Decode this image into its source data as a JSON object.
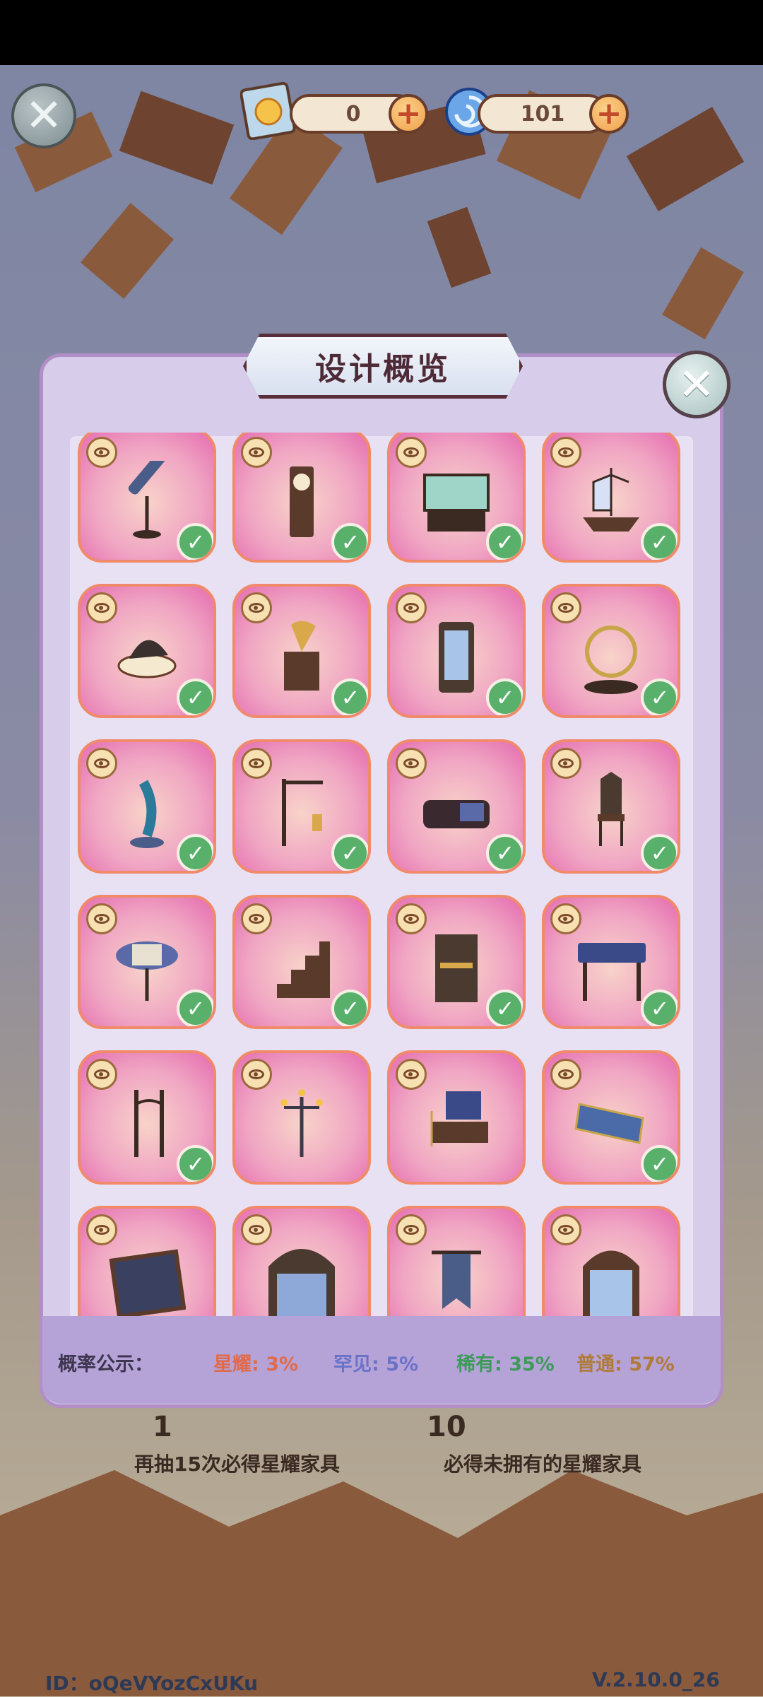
{
  "hud": {
    "currency1_value": "0",
    "currency2_value": "101"
  },
  "modal": {
    "title": "设计概览",
    "cards": [
      {
        "item": "telescope",
        "owned": true
      },
      {
        "item": "grandfather-clock",
        "owned": true
      },
      {
        "item": "aquarium",
        "owned": true
      },
      {
        "item": "ship-model",
        "owned": true
      },
      {
        "item": "dragon-table",
        "owned": true
      },
      {
        "item": "gramophone",
        "owned": true
      },
      {
        "item": "display-cabinet",
        "owned": true
      },
      {
        "item": "astrolabe",
        "owned": true
      },
      {
        "item": "peacock-statue",
        "owned": true
      },
      {
        "item": "lantern-stand",
        "owned": true
      },
      {
        "item": "sofa",
        "owned": true
      },
      {
        "item": "gothic-chair",
        "owned": true
      },
      {
        "item": "chess-table",
        "owned": true
      },
      {
        "item": "staircase",
        "owned": true
      },
      {
        "item": "desk-cabinet",
        "owned": true
      },
      {
        "item": "starry-table",
        "owned": true
      },
      {
        "item": "street-lamp",
        "owned": true
      },
      {
        "item": "candelabra",
        "owned": false
      },
      {
        "item": "scale-desk",
        "owned": false
      },
      {
        "item": "star-rug",
        "owned": true
      },
      {
        "item": "butterfly-frame",
        "owned": false
      },
      {
        "item": "arched-window",
        "owned": false
      },
      {
        "item": "banner",
        "owned": false
      },
      {
        "item": "curio-cabinet",
        "owned": false
      }
    ]
  },
  "probability": {
    "label": "概率公示：",
    "entries": [
      {
        "text": "星耀: 3%",
        "color": "#e06a4a"
      },
      {
        "text": "罕见: 5%",
        "color": "#6a72c8"
      },
      {
        "text": "稀有: 35%",
        "color": "#3f9a5a"
      },
      {
        "text": "普通: 57%",
        "color": "#b07a3a"
      }
    ]
  },
  "background": {
    "left_hint": "再抽15次必得星耀家具",
    "right_hint": "必得未拥有的星耀家具",
    "left_count": "1",
    "right_count": "10"
  },
  "footer": {
    "id_text": "ID：oQeVYozCxUKu",
    "version_text": "V.2.10.0_26"
  },
  "colors": {
    "card_border": "#f08a6a",
    "check_green": "#58b06a",
    "modal_bg": "#d7cdea"
  }
}
